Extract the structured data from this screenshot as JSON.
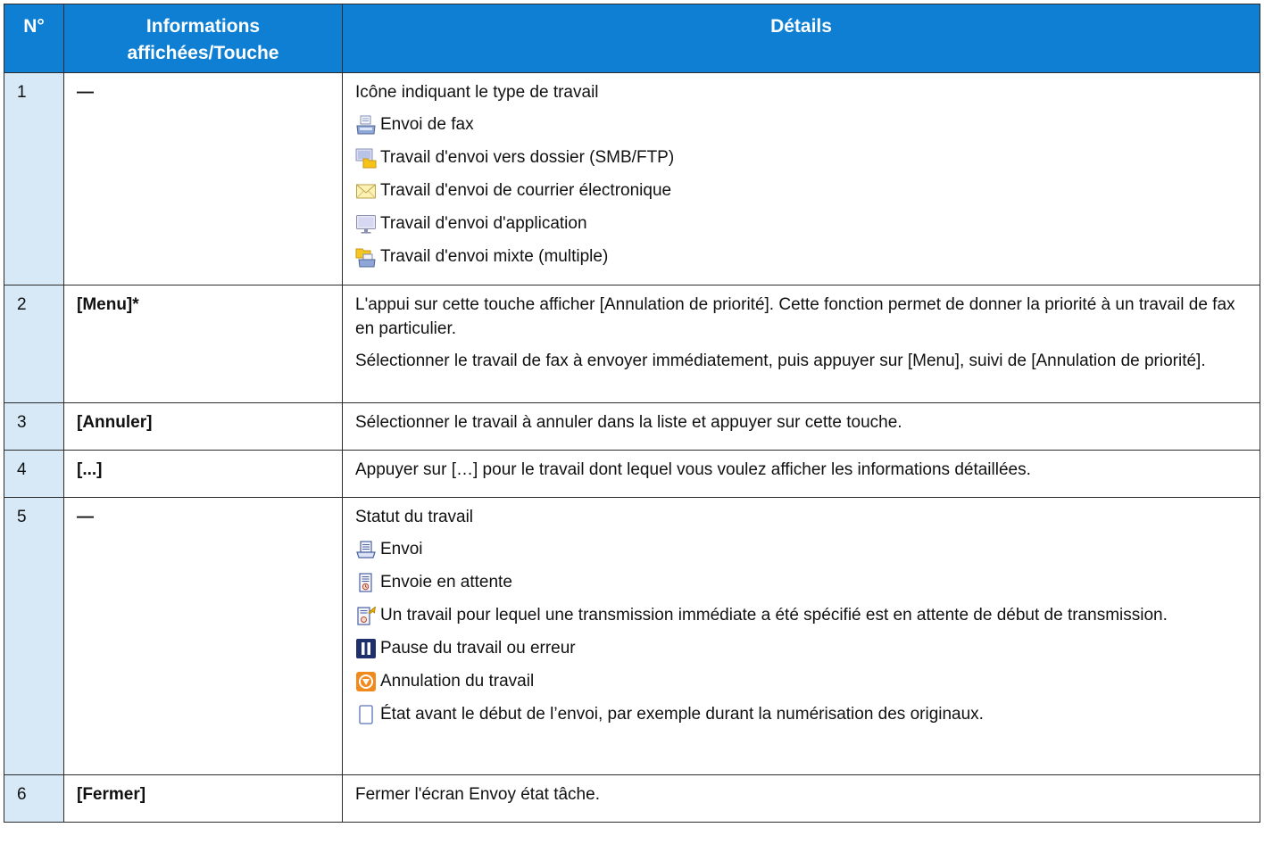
{
  "headers": {
    "no": "N°",
    "info": "Informations affichées/Touche",
    "details": "Détails"
  },
  "rows": [
    {
      "no": "1",
      "key": "—",
      "details": [
        {
          "kind": "text",
          "text": "Icône indiquant le type de travail"
        },
        {
          "kind": "item",
          "icon": "fax-job-icon",
          "text": "Envoi de fax"
        },
        {
          "kind": "item",
          "icon": "folder-send-icon",
          "text": "Travail d'envoi vers dossier (SMB/FTP)"
        },
        {
          "kind": "item",
          "icon": "email-envelope-icon",
          "text": "Travail d'envoi de courrier électronique"
        },
        {
          "kind": "item",
          "icon": "application-monitor-icon",
          "text": "Travail d'envoi d'application"
        },
        {
          "kind": "item",
          "icon": "mixed-send-icon",
          "text": "Travail d'envoi mixte (multiple)"
        }
      ]
    },
    {
      "no": "2",
      "key": "[Menu]*",
      "details": [
        {
          "kind": "text",
          "text": "L'appui sur cette touche afficher [Annulation de priorité]. Cette fonction permet de donner la priorité à un travail de fax en particulier."
        },
        {
          "kind": "text",
          "text": "Sélectionner le travail de fax à envoyer immédiatement, puis appuyer sur [Menu], suivi de [Annulation de priorité]."
        }
      ]
    },
    {
      "no": "3",
      "key": "[Annuler]",
      "details": [
        {
          "kind": "text",
          "text": "Sélectionner le travail à annuler dans la liste et appuyer sur cette touche."
        }
      ]
    },
    {
      "no": "4",
      "key": "[...]",
      "details": [
        {
          "kind": "text",
          "text": "Appuyer sur […] pour le travail dont lequel vous voulez afficher les informations détaillées."
        }
      ]
    },
    {
      "no": "5",
      "key": "—",
      "details": [
        {
          "kind": "text",
          "text": "Statut du travail"
        },
        {
          "kind": "item",
          "icon": "sending-tray-icon",
          "text": "Envoi"
        },
        {
          "kind": "item",
          "icon": "waiting-document-icon",
          "text": "Envoie en attente"
        },
        {
          "kind": "item",
          "icon": "immediate-waiting-icon",
          "text": "Un travail pour lequel une transmission immédiate a été spécifié est en attente de début de transmission."
        },
        {
          "kind": "item",
          "icon": "pause-icon",
          "text": "Pause du travail ou erreur"
        },
        {
          "kind": "item",
          "icon": "cancel-job-icon",
          "text": "Annulation du travail"
        },
        {
          "kind": "item",
          "icon": "blank-page-icon",
          "text": "État avant le début de l’envoi, par exemple durant la numérisation des originaux."
        }
      ]
    },
    {
      "no": "6",
      "key": "[Fermer]",
      "details": [
        {
          "kind": "text",
          "text": "Fermer l'écran Envoy état tâche."
        }
      ]
    }
  ]
}
